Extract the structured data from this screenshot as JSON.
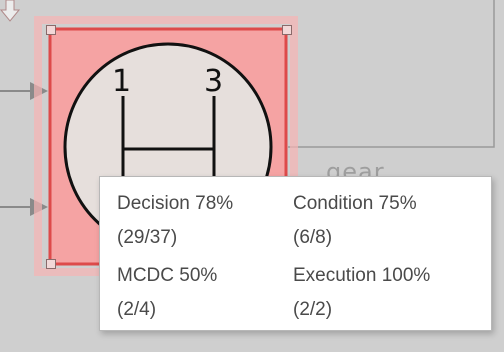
{
  "block": {
    "label": "gear",
    "numbers": [
      "1",
      "3"
    ],
    "highlight_color": "#f5a3a3",
    "icon": "down-arrow-icon"
  },
  "tooltip": {
    "metrics": [
      {
        "label": "Decision 78%",
        "value": "(29/37)"
      },
      {
        "label": "Condition 75%",
        "value": "(6/8)"
      },
      {
        "label": "MCDC 50%",
        "value": "(2/4)"
      },
      {
        "label": "Execution 100%",
        "value": "(2/2)"
      }
    ]
  }
}
